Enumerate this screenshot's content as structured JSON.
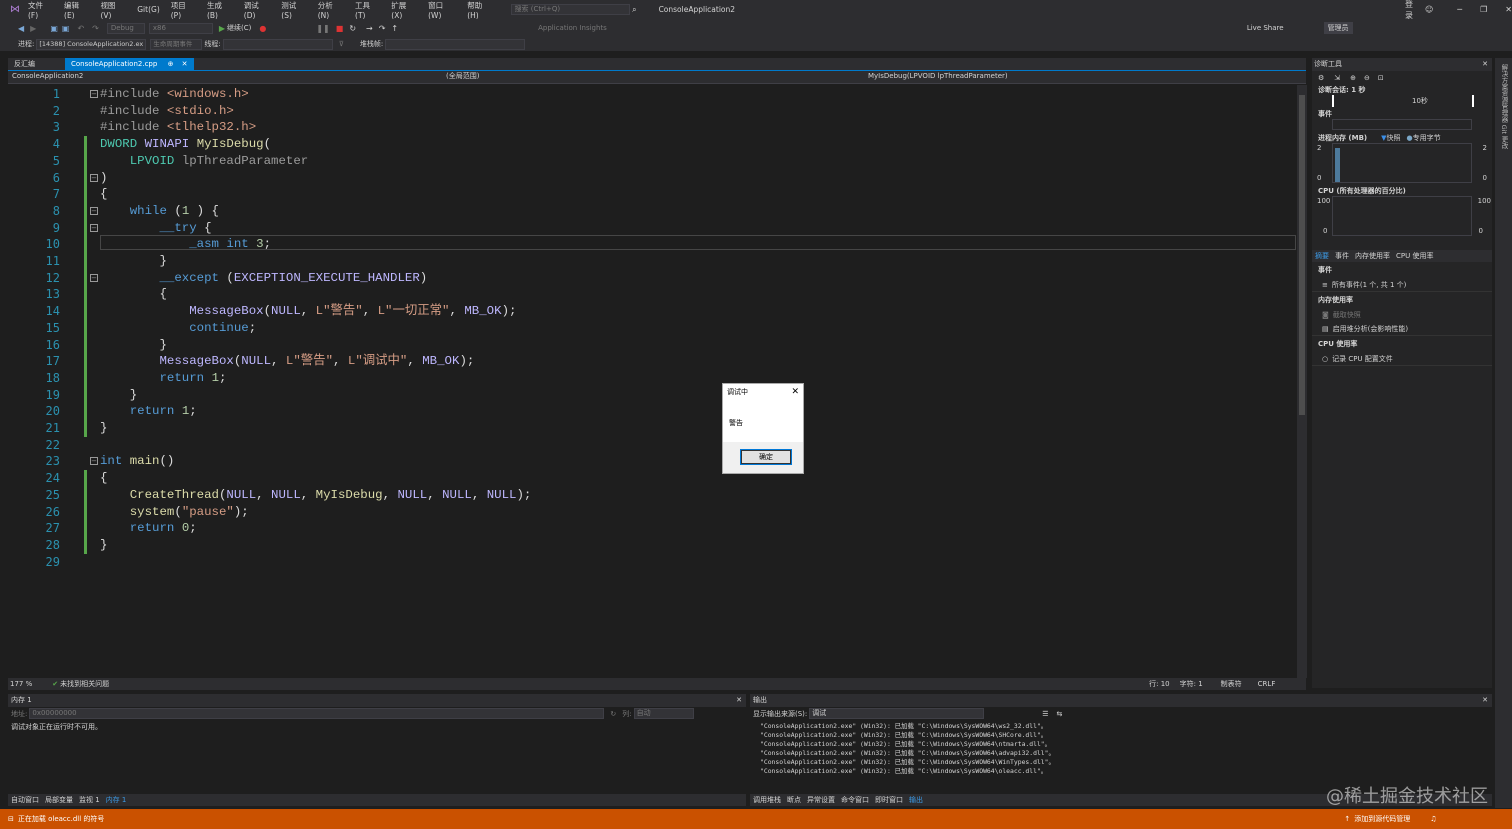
{
  "menubar": {
    "items": [
      "文件(F)",
      "编辑(E)",
      "视图(V)",
      "Git(G)",
      "项目(P)",
      "生成(B)",
      "调试(D)",
      "测试(S)",
      "分析(N)",
      "工具(T)",
      "扩展(X)",
      "窗口(W)",
      "帮助(H)"
    ],
    "search_placeholder": "搜索 (Ctrl+Q)",
    "title": "ConsoleApplication2",
    "login": "登录",
    "admin": "管理员",
    "liveshare": "Live Share"
  },
  "toolbar": {
    "config": "Debug",
    "platform": "x86",
    "continue": "继续(C)",
    "insights": "Application Insights"
  },
  "procbar": {
    "process_label": "进程:",
    "process": "[14388] ConsoleApplication2.ex",
    "lifecycle": "生命周期事件",
    "thread_label": "线程:",
    "stack_label": "堆栈帧:"
  },
  "tabs": {
    "disasm": "反汇编",
    "active": "ConsoleApplication2.cpp"
  },
  "navbar": {
    "project": "ConsoleApplication2",
    "scope": "(全局范围)",
    "func": "MyIsDebug(LPVOID lpThreadParameter)"
  },
  "code_lines": [
    [
      [
        "pp",
        "#include "
      ],
      [
        "inc",
        "<windows.h>"
      ]
    ],
    [
      [
        "pp",
        "#include "
      ],
      [
        "inc",
        "<stdio.h>"
      ]
    ],
    [
      [
        "pp",
        "#include "
      ],
      [
        "inc",
        "<tlhelp32.h>"
      ]
    ],
    [
      [
        "ty",
        "DWORD "
      ],
      [
        "mac",
        "WINAPI "
      ],
      [
        "fn",
        "MyIsDebug"
      ],
      [
        "",
        "("
      ]
    ],
    [
      [
        "",
        "    "
      ],
      [
        "ty",
        "LPVOID "
      ],
      [
        "pp",
        "lpThreadParameter"
      ]
    ],
    [
      [
        "",
        ")"
      ]
    ],
    [
      [
        "",
        "{"
      ]
    ],
    [
      [
        "",
        "    "
      ],
      [
        "kw",
        "while "
      ],
      [
        "",
        "("
      ],
      [
        "num",
        "1"
      ],
      [
        "",
        " ) {"
      ]
    ],
    [
      [
        "",
        "        "
      ],
      [
        "kw",
        "__try "
      ],
      [
        "",
        "{"
      ]
    ],
    [
      [
        "",
        "            "
      ],
      [
        "kw",
        "_asm "
      ],
      [
        "kw",
        "int "
      ],
      [
        "num",
        "3"
      ],
      [
        "",
        ";"
      ]
    ],
    [
      [
        "",
        "        }"
      ]
    ],
    [
      [
        "",
        "        "
      ],
      [
        "kw",
        "__except "
      ],
      [
        "",
        "("
      ],
      [
        "mac",
        "EXCEPTION_EXECUTE_HANDLER"
      ],
      [
        "",
        ")"
      ]
    ],
    [
      [
        "",
        "        {"
      ]
    ],
    [
      [
        "",
        "            "
      ],
      [
        "mac",
        "MessageBox"
      ],
      [
        "",
        "("
      ],
      [
        "mac",
        "NULL"
      ],
      [
        "",
        ", "
      ],
      [
        "str",
        "L\"警告\""
      ],
      [
        "",
        ", "
      ],
      [
        "str",
        "L\"一切正常\""
      ],
      [
        "",
        ", "
      ],
      [
        "mac",
        "MB_OK"
      ],
      [
        "",
        ");"
      ]
    ],
    [
      [
        "",
        "            "
      ],
      [
        "kw",
        "continue"
      ],
      [
        "",
        ";"
      ]
    ],
    [
      [
        "",
        "        }"
      ]
    ],
    [
      [
        "",
        "        "
      ],
      [
        "mac",
        "MessageBox"
      ],
      [
        "",
        "("
      ],
      [
        "mac",
        "NULL"
      ],
      [
        "",
        ", "
      ],
      [
        "str",
        "L\"警告\""
      ],
      [
        "",
        ", "
      ],
      [
        "str",
        "L\"调试中\""
      ],
      [
        "",
        ", "
      ],
      [
        "mac",
        "MB_OK"
      ],
      [
        "",
        ");"
      ]
    ],
    [
      [
        "",
        "        "
      ],
      [
        "kw",
        "return "
      ],
      [
        "num",
        "1"
      ],
      [
        "",
        ";"
      ]
    ],
    [
      [
        "",
        "    }"
      ]
    ],
    [
      [
        "",
        "    "
      ],
      [
        "kw",
        "return "
      ],
      [
        "num",
        "1"
      ],
      [
        "",
        ";"
      ]
    ],
    [
      [
        "",
        "}"
      ]
    ],
    [
      [
        "",
        ""
      ]
    ],
    [
      [
        "kw",
        "int "
      ],
      [
        "fn",
        "main"
      ],
      [
        "",
        "()"
      ]
    ],
    [
      [
        "",
        "{"
      ]
    ],
    [
      [
        "",
        "    "
      ],
      [
        "fn",
        "CreateThread"
      ],
      [
        "",
        "("
      ],
      [
        "mac",
        "NULL"
      ],
      [
        "",
        ", "
      ],
      [
        "mac",
        "NULL"
      ],
      [
        "",
        ", "
      ],
      [
        "fn",
        "MyIsDebug"
      ],
      [
        "",
        ", "
      ],
      [
        "mac",
        "NULL"
      ],
      [
        "",
        ", "
      ],
      [
        "mac",
        "NULL"
      ],
      [
        "",
        ", "
      ],
      [
        "mac",
        "NULL"
      ],
      [
        "",
        ");"
      ]
    ],
    [
      [
        "",
        "    "
      ],
      [
        "fn",
        "system"
      ],
      [
        "",
        "("
      ],
      [
        "str",
        "\"pause\""
      ],
      [
        "",
        ");"
      ]
    ],
    [
      [
        "",
        "    "
      ],
      [
        "kw",
        "return "
      ],
      [
        "num",
        "0"
      ],
      [
        "",
        ";"
      ]
    ],
    [
      [
        "",
        "}"
      ]
    ],
    [
      [
        "",
        ""
      ]
    ]
  ],
  "editor_status": {
    "zoom": "177 %",
    "issues": "未找到相关问题",
    "line": "行: 10",
    "char": "字符: 1",
    "tabs": "制表符",
    "eol": "CRLF"
  },
  "diag": {
    "title": "诊断工具",
    "session": "诊断会话: 1 秒",
    "tick": "10秒",
    "events": "事件",
    "memory": "进程内存 (MB)",
    "snapshot": "快照",
    "private": "专用字节",
    "mem_top": "2",
    "mem_bot": "0",
    "cpu": "CPU (所有处理器的百分比)",
    "cpu_top": "100",
    "cpu_bot": "0",
    "tabs": [
      "摘要",
      "事件",
      "内存使用率",
      "CPU 使用率"
    ],
    "sec_events": "事件",
    "all_events": "所有事件(1 个, 共 1 个)",
    "sec_mem": "内存使用率",
    "take_snapshot": "截取快照",
    "heap": "启用堆分析(会影响性能)",
    "sec_cpu": "CPU 使用率",
    "record_cpu": "记录 CPU 配置文件"
  },
  "right_strip": "解决方案资源管理器  Git 更改",
  "mem": {
    "title": "内存 1",
    "addr_label": "地址:",
    "addr": "0x00000000",
    "cols": "列:",
    "cols_val": "自动",
    "message": "调试对象正在运行时不可用。",
    "tabs": [
      "自动窗口",
      "局部变量",
      "监视 1",
      "内存 1"
    ]
  },
  "output": {
    "title": "输出",
    "source_label": "显示输出来源(S):",
    "source": "调试",
    "lines": [
      "\"ConsoleApplication2.exe\" (Win32): 已加载 \"C:\\Windows\\SysWOW64\\ws2_32.dll\"。",
      "\"ConsoleApplication2.exe\" (Win32): 已加载 \"C:\\Windows\\SysWOW64\\SHCore.dll\"。",
      "\"ConsoleApplication2.exe\" (Win32): 已加载 \"C:\\Windows\\SysWOW64\\ntmarta.dll\"。",
      "\"ConsoleApplication2.exe\" (Win32): 已加载 \"C:\\Windows\\SysWOW64\\advapi32.dll\"。",
      "\"ConsoleApplication2.exe\" (Win32): 已加载 \"C:\\Windows\\SysWOW64\\WinTypes.dll\"。",
      "\"ConsoleApplication2.exe\" (Win32): 已加载 \"C:\\Windows\\SysWOW64\\oleacc.dll\"。"
    ],
    "tabs": [
      "调用堆栈",
      "断点",
      "异常设置",
      "命令窗口",
      "即时窗口",
      "输出"
    ]
  },
  "statusbar": {
    "loading": "正在加载 oleacc.dll 的符号",
    "source_control": "添加到源代码管理"
  },
  "dialog": {
    "title": "调试中",
    "message": "警告",
    "ok": "确定"
  },
  "watermark": "@稀土掘金技术社区",
  "colors": {
    "accent": "#007acc",
    "status": "#ca5100"
  }
}
